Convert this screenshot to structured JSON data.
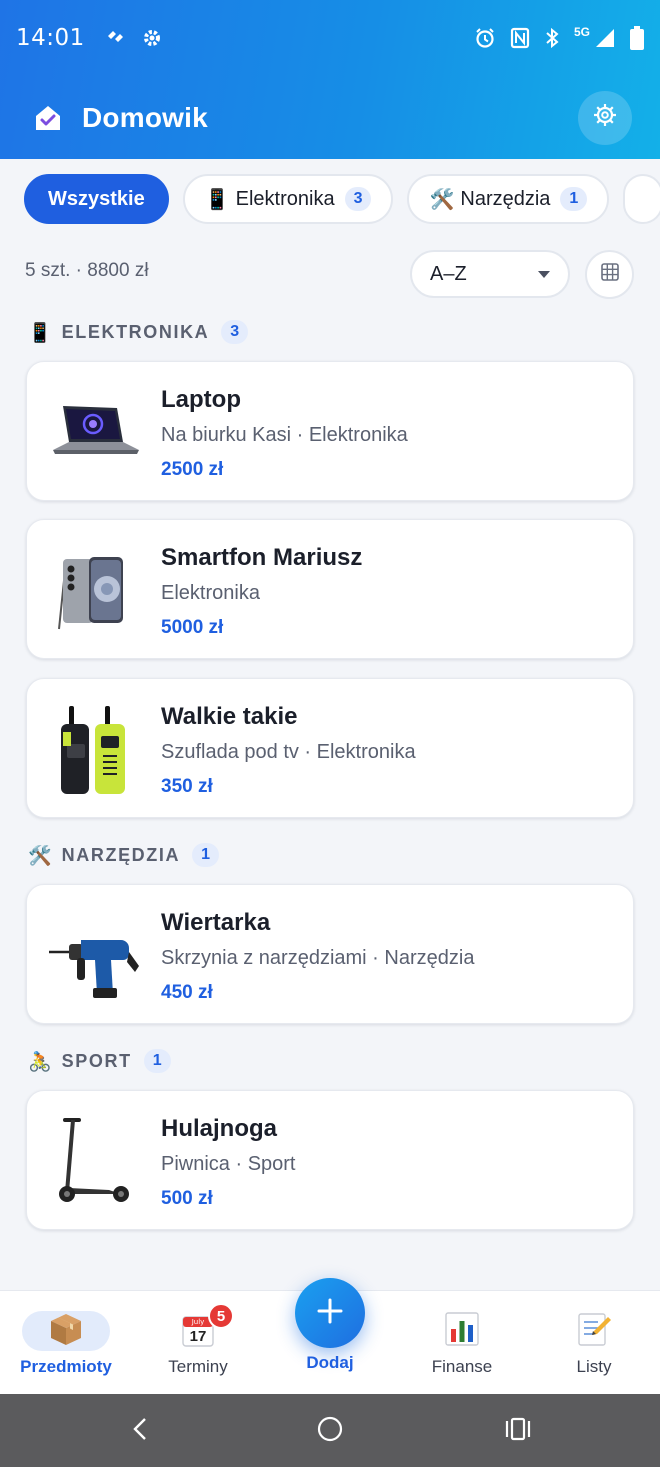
{
  "status_bar": {
    "time": "14:01",
    "network": "5G"
  },
  "app": {
    "title": "Domowik"
  },
  "filters": [
    {
      "label": "Wszystkie",
      "active": true
    },
    {
      "emoji": "📱",
      "label": "Elektronika",
      "count": "3"
    },
    {
      "emoji": "🛠️",
      "label": "Narzędzia",
      "count": "1"
    }
  ],
  "summary": {
    "text": "5 szt. · 8800 zł",
    "sort_value": "A–Z"
  },
  "sections": [
    {
      "emoji": "📱",
      "name": "ELEKTRONIKA",
      "count": "3",
      "items": [
        {
          "title": "Laptop",
          "subtitle": "Na biurku Kasi · Elektronika",
          "price": "2500 zł",
          "icon": "laptop-image"
        },
        {
          "title": "Smartfon Mariusz",
          "subtitle": "Elektronika",
          "price": "5000 zł",
          "icon": "smartphone-image"
        },
        {
          "title": "Walkie takie",
          "subtitle": "Szuflada pod tv · Elektronika",
          "price": "350 zł",
          "icon": "walkie-talkie-image"
        }
      ]
    },
    {
      "emoji": "🛠️",
      "name": "NARZĘDZIA",
      "count": "1",
      "items": [
        {
          "title": "Wiertarka",
          "subtitle": "Skrzynia z narzędziami · Narzędzia",
          "price": "450 zł",
          "icon": "drill-image"
        }
      ]
    },
    {
      "emoji": "🚴",
      "name": "SPORT",
      "count": "1",
      "items": [
        {
          "title": "Hulajnoga",
          "subtitle": "Piwnica · Sport",
          "price": "500 zł",
          "icon": "scooter-image"
        }
      ]
    }
  ],
  "bottom_nav": {
    "items": [
      {
        "label": "Przedmioty",
        "icon": "package-icon",
        "active": true
      },
      {
        "label": "Terminy",
        "icon": "calendar-icon",
        "badge": "5",
        "calendar_month": "July",
        "calendar_day": "17"
      },
      {
        "label": "Dodaj",
        "icon": "plus-icon"
      },
      {
        "label": "Finanse",
        "icon": "bar-chart-icon"
      },
      {
        "label": "Listy",
        "icon": "memo-icon"
      }
    ]
  },
  "colors": {
    "primary": "#1f5fe0",
    "header_gradient_start": "#1f74e6",
    "header_gradient_end": "#13b0e8",
    "badge_red": "#e53935"
  }
}
